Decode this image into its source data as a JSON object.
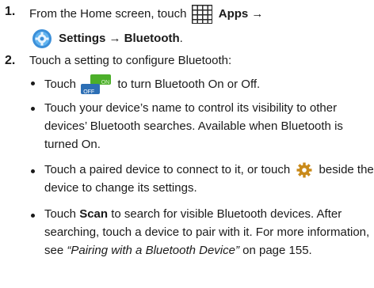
{
  "steps": [
    {
      "number": "1.",
      "line1_pre": "From the Home screen, touch",
      "apps_label": "Apps →",
      "settings_label": "Settings → Bluetooth",
      "settings_end": "."
    },
    {
      "number": "2.",
      "intro": "Touch a setting to configure Bluetooth:"
    }
  ],
  "bullets": {
    "toggle_pre": "Touch",
    "toggle_post": "to turn Bluetooth On or Off.",
    "toggle_on_text": "ON",
    "toggle_off_text": "OFF",
    "name_line1": "Touch your device’s name to control its visibility to other",
    "name_line2": "devices’ Bluetooth searches. Available when Bluetooth is",
    "name_line3": "turned On.",
    "paired_pre": "Touch a paired device to connect to it, or touch",
    "paired_post": "beside the",
    "paired_line2": "device to change its settings.",
    "scan_pre": "Touch",
    "scan_bold": "Scan",
    "scan_post": "to search for visible Bluetooth devices. After",
    "scan_line2": "searching, touch a device to pair with it. For more information,",
    "scan_line3_pre": "see",
    "scan_link": "“Pairing with a Bluetooth Device”",
    "scan_line3_post": "on page 155."
  }
}
